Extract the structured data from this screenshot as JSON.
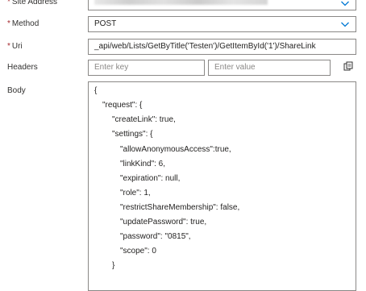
{
  "fields": {
    "site_address": {
      "label": "Site Address"
    },
    "method": {
      "label": "Method",
      "value": "POST"
    },
    "uri": {
      "label": "Uri",
      "value": "_api/web/Lists/GetByTitle('Testen')/GetItemById('1')/ShareLink"
    },
    "headers": {
      "label": "Headers",
      "key_placeholder": "Enter key",
      "value_placeholder": "Enter value"
    },
    "body": {
      "label": "Body",
      "lines": [
        "{",
        "\"request\": {",
        "\"createLink\": true,",
        "\"settings\": {",
        "\"allowAnonymousAccess\":true,",
        "\"linkKind\": 6,",
        "\"expiration\": null,",
        "\"role\": 1,",
        "\"restrictShareMembership\": false,",
        "\"updatePassword\": true,",
        "\"password\": \"0815\",",
        "\"scope\": 0",
        "}"
      ]
    }
  },
  "required_marker": "*",
  "icons": {
    "dropdown": "chevron-down-icon",
    "headers_toggle": "switch-to-text-mode-icon"
  },
  "colors": {
    "required": "#a4262c",
    "border": "#8a8886",
    "chevron": "#0078d4"
  }
}
